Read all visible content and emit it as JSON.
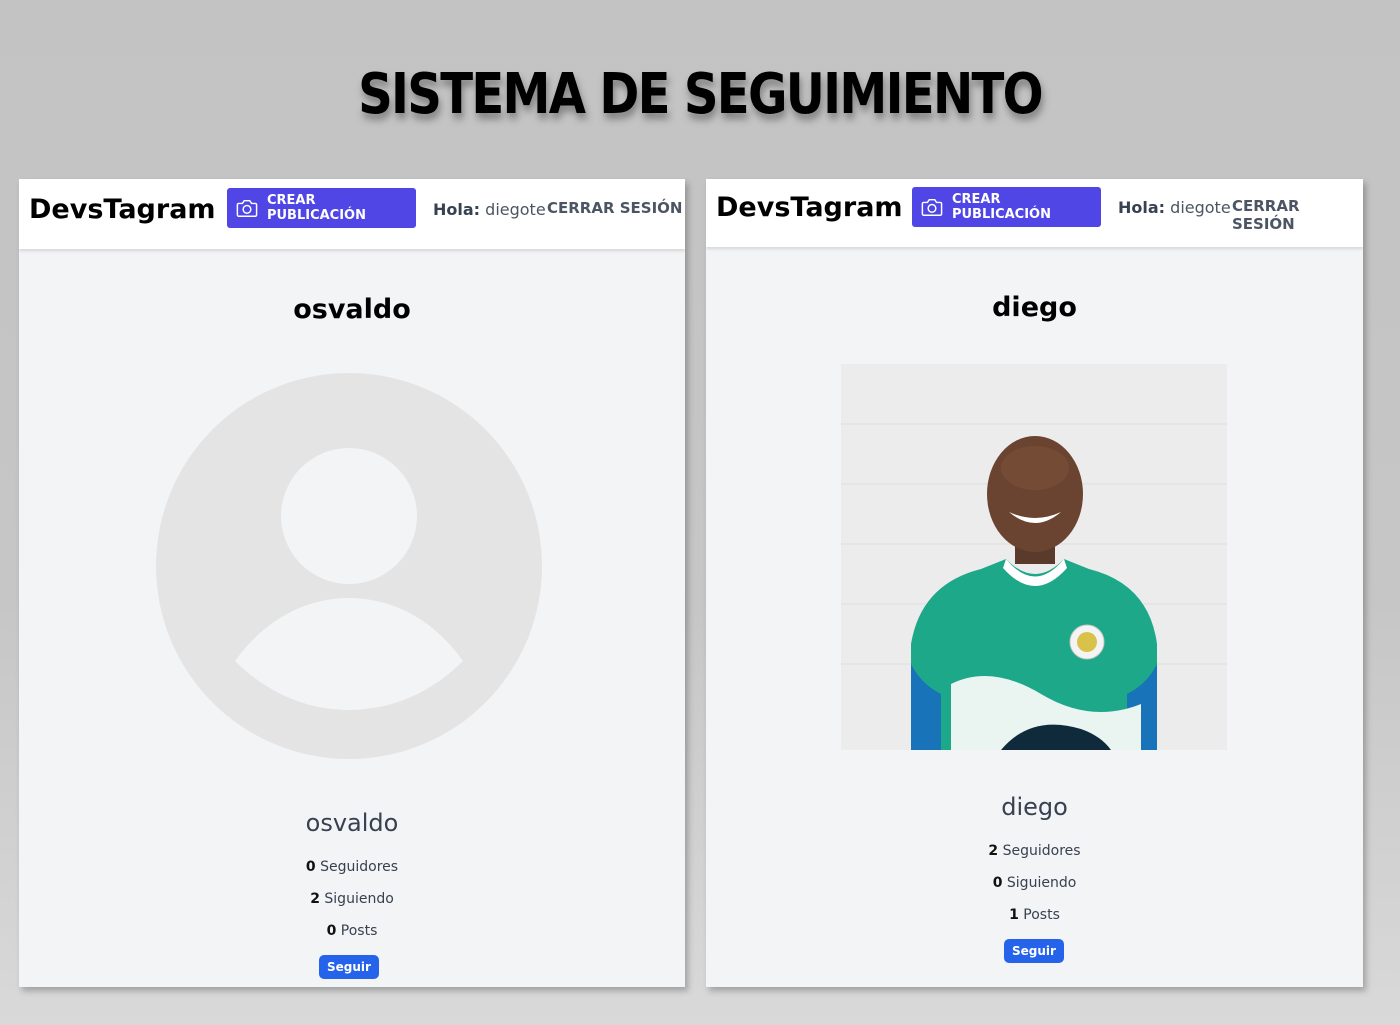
{
  "headline": "SISTEMA DE SEGUIMIENTO",
  "panels": [
    {
      "nav": {
        "brand": "DevsTagram",
        "create_label": "CREAR PUBLICACIÓN",
        "greeting_label": "Hola:",
        "greeting_user": "diegote",
        "logout_label": "CERRAR SESIÓN"
      },
      "profile": {
        "title": "osvaldo",
        "username": "osvaldo",
        "avatar": "default-user-icon",
        "followers": {
          "count": "0",
          "label": "Seguidores"
        },
        "following": {
          "count": "2",
          "label": "Siguiendo"
        },
        "posts": {
          "count": "0",
          "label": "Posts"
        },
        "follow_label": "Seguir"
      }
    },
    {
      "nav": {
        "brand": "DevsTagram",
        "create_label": "CREAR PUBLICACIÓN",
        "greeting_label": "Hola:",
        "greeting_user": "diegote",
        "logout_label": "CERRAR SESIÓN"
      },
      "profile": {
        "title": "diego",
        "username": "diego",
        "avatar": "profile-photo",
        "followers": {
          "count": "2",
          "label": "Seguidores"
        },
        "following": {
          "count": "0",
          "label": "Siguiendo"
        },
        "posts": {
          "count": "1",
          "label": "Posts"
        },
        "follow_label": "Seguir"
      }
    }
  ],
  "colors": {
    "primary_button": "#4f46e5",
    "follow_button": "#2563eb",
    "panel_background": "#f3f4f6"
  }
}
